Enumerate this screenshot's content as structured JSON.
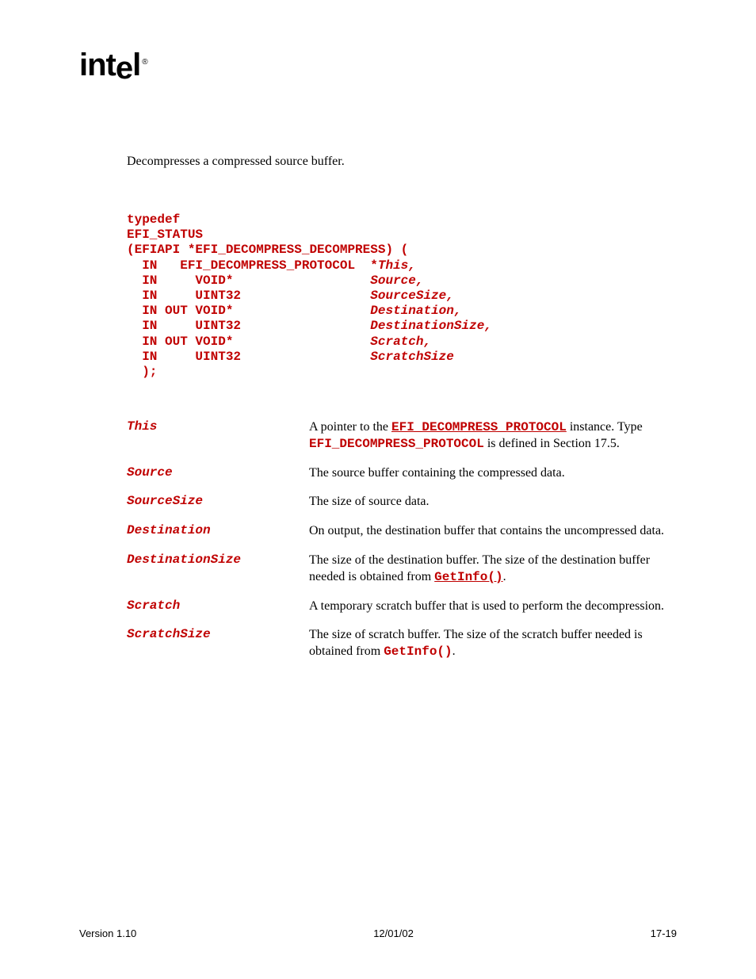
{
  "logo": "intel",
  "summary": "Decompresses a compressed source buffer.",
  "code": {
    "line1": "typedef",
    "line2": "EFI_STATUS",
    "line3a": "(EFIAPI *EFI_DECOMPRESS_DECOMPRESS) (",
    "p1_mod": "  IN   ",
    "p1_type": "EFI_DECOMPRESS_PROTOCOL  ",
    "p1_star": "*",
    "p1_name": "This,",
    "p2_mod": "  IN     ",
    "p2_type": "VOID*                  ",
    "p2_name": "Source,",
    "p3_mod": "  IN     ",
    "p3_type": "UINT32                 ",
    "p3_name": "SourceSize,",
    "p4_mod": "  IN OUT ",
    "p4_type": "VOID*                  ",
    "p4_name": "Destination,",
    "p5_mod": "  IN     ",
    "p5_type": "UINT32                 ",
    "p5_name": "DestinationSize,",
    "p6_mod": "  IN OUT ",
    "p6_type": "VOID*                  ",
    "p6_name": "Scratch,",
    "p7_mod": "  IN     ",
    "p7_type": "UINT32                 ",
    "p7_name": "ScratchSize",
    "close": "  );"
  },
  "params": {
    "this": {
      "name": "This",
      "desc_pre": "A pointer to the ",
      "link1": "EFI_DECOMPRESS_PROTOCOL",
      "desc_mid": " instance. Type ",
      "code1": "EFI_DECOMPRESS_PROTOCOL",
      "desc_post": " is defined in Section 17.5."
    },
    "source": {
      "name": "Source",
      "desc": "The source buffer containing the compressed data."
    },
    "sourcesize": {
      "name": "SourceSize",
      "desc": "The size of source data."
    },
    "destination": {
      "name": "Destination",
      "desc": "On output, the destination buffer that contains the uncompressed data."
    },
    "destinationsize": {
      "name": "DestinationSize",
      "desc_pre": "The size of the destination buffer.  The size of the destination buffer needed is obtained from ",
      "link1": "GetInfo()",
      "desc_post": "."
    },
    "scratch": {
      "name": "Scratch",
      "desc": "A temporary scratch buffer that is used to perform the decompression."
    },
    "scratchsize": {
      "name": "ScratchSize",
      "desc_pre": "The size of scratch buffer.  The size of the scratch buffer needed is obtained from ",
      "code1": "GetInfo()",
      "desc_post": "."
    }
  },
  "footer": {
    "left": "Version 1.10",
    "center": "12/01/02",
    "right": "17-19"
  }
}
